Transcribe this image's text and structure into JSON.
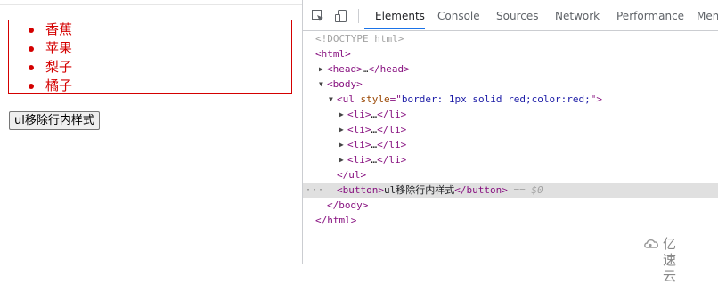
{
  "page": {
    "list_items": [
      "香蕉",
      "苹果",
      "梨子",
      "橘子"
    ],
    "remove_button_label": "ul移除行内样式"
  },
  "devtools": {
    "tabs": [
      "Elements",
      "Console",
      "Sources",
      "Network",
      "Performance",
      "Mem"
    ],
    "active_tab": "Elements",
    "accent_color": "#1a73e8",
    "tree": {
      "doctype": "<!DOCTYPE html>",
      "html_open": "<html>",
      "head": "<head>",
      "head_ellipsis": "…",
      "head_close": "</head>",
      "body_open": "<body>",
      "ul_open_tag": "<ul",
      "ul_attr_name": "style",
      "ul_attr_eq": "=\"",
      "ul_attr_value": "border: 1px solid red;color:red;",
      "ul_attr_close": "\">",
      "li_open": "<li>",
      "li_ellipsis": "…",
      "li_close": "</li>",
      "ul_close": "</ul>",
      "button_open": "<button>",
      "button_text": "ul移除行内样式",
      "button_close": "</button>",
      "selected_marker": "== $0",
      "selected_dots": "···",
      "body_close": "</body>",
      "html_close": "</html>"
    }
  },
  "watermark": {
    "text": "亿速云"
  },
  "colors": {
    "list_red": "#d40000",
    "tag": "#881280",
    "attr_name": "#994500",
    "attr_value": "#1a1aa6"
  }
}
